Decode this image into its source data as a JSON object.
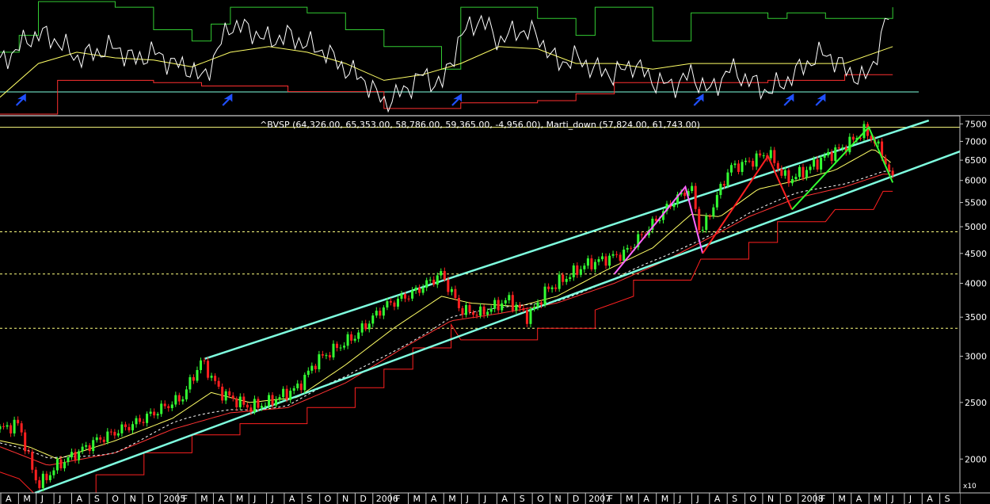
{
  "colors": {
    "background": "#000000",
    "axis": "#c8c8c8",
    "channel": "#7fffe0",
    "guide_level": "#ffff80",
    "price_up": "#33ff33",
    "price_down": "#ff2020",
    "ma_fast": "#ffff66",
    "ma_slow": "#ff3333",
    "stop_line": "#ff2020",
    "osc_white": "#ffffff",
    "osc_yellow": "#ffff66",
    "osc_red": "#ff3030",
    "osc_green": "#33cc33",
    "osc_baseline": "#7fffe0",
    "zigzag_pink": "#ff66ff",
    "zigzag_red": "#ff2020",
    "zigzag_green": "#33ff33",
    "signal_arrow": "#2050ff"
  },
  "chart_data": {
    "type": "candlestick",
    "title": "^BVSP (64,326.00, 65,353.00, 58,786.00, 59,365.00, -4,956.00), Marti_down (57,824.00, 61,743.00)",
    "y_scale": "log",
    "y_multiplier_label": "x10",
    "ylim": [
      17500,
      76500
    ],
    "y_tick_labels": [
      "7500",
      "7000",
      "6500",
      "6000",
      "5500",
      "5000",
      "4500",
      "4000",
      "3500",
      "3000",
      "2500",
      "2000"
    ],
    "y_ticks": [
      75000,
      70000,
      65000,
      60000,
      55000,
      50000,
      45000,
      40000,
      35000,
      30000,
      25000,
      20000
    ],
    "x_labels": [
      "A",
      "M",
      "J",
      "J",
      "A",
      "S",
      "O",
      "N",
      "D",
      "2005",
      "F",
      "M",
      "A",
      "M",
      "J",
      "J",
      "A",
      "S",
      "O",
      "N",
      "D",
      "2006",
      "F",
      "M",
      "A",
      "M",
      "J",
      "J",
      "A",
      "S",
      "O",
      "N",
      "D",
      "2007",
      "F",
      "M",
      "A",
      "M",
      "J",
      "J",
      "A",
      "S",
      "O",
      "N",
      "D",
      "2008",
      "F",
      "M",
      "A",
      "M",
      "J",
      "J",
      "A",
      "S"
    ],
    "horizontal_levels": [
      74000,
      49000,
      41500,
      33500
    ],
    "channel_upper": [
      [
        0.2135,
        29700
      ],
      [
        0.9676,
        76000
      ]
    ],
    "channel_lower": [
      [
        0.0363,
        17500
      ],
      [
        0.9676,
        64300
      ]
    ],
    "price_anchors": [
      [
        0.0,
        22500
      ],
      [
        0.02,
        23000
      ],
      [
        0.03,
        20000
      ],
      [
        0.04,
        18000
      ],
      [
        0.06,
        19500
      ],
      [
        0.1,
        21500
      ],
      [
        0.14,
        23000
      ],
      [
        0.17,
        24500
      ],
      [
        0.19,
        25500
      ],
      [
        0.21,
        29500
      ],
      [
        0.23,
        26000
      ],
      [
        0.26,
        24500
      ],
      [
        0.28,
        25000
      ],
      [
        0.31,
        26500
      ],
      [
        0.33,
        29500
      ],
      [
        0.37,
        32500
      ],
      [
        0.4,
        36500
      ],
      [
        0.43,
        38500
      ],
      [
        0.46,
        41500
      ],
      [
        0.48,
        36000
      ],
      [
        0.5,
        35500
      ],
      [
        0.53,
        37500
      ],
      [
        0.55,
        35000
      ],
      [
        0.57,
        39000
      ],
      [
        0.61,
        43000
      ],
      [
        0.65,
        45000
      ],
      [
        0.67,
        48500
      ],
      [
        0.7,
        55000
      ],
      [
        0.72,
        58500
      ],
      [
        0.73,
        48500
      ],
      [
        0.74,
        53000
      ],
      [
        0.76,
        63000
      ],
      [
        0.78,
        64500
      ],
      [
        0.8,
        67000
      ],
      [
        0.82,
        60000
      ],
      [
        0.84,
        62500
      ],
      [
        0.86,
        66000
      ],
      [
        0.88,
        68500
      ],
      [
        0.9,
        73000
      ],
      [
        0.91,
        70500
      ],
      [
        0.92,
        66000
      ],
      [
        0.93,
        60000
      ]
    ],
    "ma_fast_anchors": [
      [
        0.0,
        21500
      ],
      [
        0.03,
        21000
      ],
      [
        0.06,
        20000
      ],
      [
        0.12,
        21500
      ],
      [
        0.18,
        23500
      ],
      [
        0.22,
        26000
      ],
      [
        0.26,
        25000
      ],
      [
        0.31,
        25500
      ],
      [
        0.36,
        29000
      ],
      [
        0.41,
        33500
      ],
      [
        0.46,
        38000
      ],
      [
        0.49,
        37000
      ],
      [
        0.54,
        36500
      ],
      [
        0.58,
        38000
      ],
      [
        0.63,
        42000
      ],
      [
        0.68,
        46000
      ],
      [
        0.72,
        52500
      ],
      [
        0.75,
        52000
      ],
      [
        0.79,
        58000
      ],
      [
        0.83,
        60000
      ],
      [
        0.87,
        62500
      ],
      [
        0.91,
        68000
      ],
      [
        0.93,
        64000
      ]
    ],
    "ma_slow_anchors": [
      [
        0.0,
        21000
      ],
      [
        0.05,
        19500
      ],
      [
        0.12,
        20500
      ],
      [
        0.18,
        22500
      ],
      [
        0.24,
        24000
      ],
      [
        0.3,
        24500
      ],
      [
        0.36,
        27000
      ],
      [
        0.42,
        31000
      ],
      [
        0.47,
        34500
      ],
      [
        0.52,
        35500
      ],
      [
        0.58,
        37000
      ],
      [
        0.64,
        40000
      ],
      [
        0.69,
        43500
      ],
      [
        0.73,
        47000
      ],
      [
        0.78,
        52000
      ],
      [
        0.83,
        56000
      ],
      [
        0.88,
        58500
      ],
      [
        0.92,
        61500
      ],
      [
        0.93,
        61500
      ]
    ],
    "stop_anchors": [
      [
        0.0,
        19000
      ],
      [
        0.02,
        18500
      ],
      [
        0.035,
        17500
      ],
      [
        0.1,
        17500
      ],
      [
        0.1,
        18800
      ],
      [
        0.15,
        18800
      ],
      [
        0.15,
        20500
      ],
      [
        0.2,
        20500
      ],
      [
        0.2,
        22000
      ],
      [
        0.25,
        22000
      ],
      [
        0.25,
        23000
      ],
      [
        0.32,
        23000
      ],
      [
        0.32,
        24500
      ],
      [
        0.37,
        24500
      ],
      [
        0.37,
        26500
      ],
      [
        0.4,
        26500
      ],
      [
        0.4,
        28500
      ],
      [
        0.43,
        28500
      ],
      [
        0.43,
        31000
      ],
      [
        0.47,
        31000
      ],
      [
        0.47,
        34000
      ],
      [
        0.48,
        32000
      ],
      [
        0.56,
        32000
      ],
      [
        0.56,
        33500
      ],
      [
        0.62,
        33500
      ],
      [
        0.62,
        36000
      ],
      [
        0.66,
        38000
      ],
      [
        0.66,
        40500
      ],
      [
        0.72,
        40500
      ],
      [
        0.73,
        44000
      ],
      [
        0.78,
        44000
      ],
      [
        0.78,
        47000
      ],
      [
        0.81,
        47000
      ],
      [
        0.81,
        51000
      ],
      [
        0.86,
        51000
      ],
      [
        0.87,
        53500
      ],
      [
        0.91,
        53500
      ],
      [
        0.92,
        57500
      ],
      [
        0.93,
        57500
      ]
    ],
    "zigzag_pink": [
      [
        0.64,
        41500
      ],
      [
        0.714,
        58500
      ],
      [
        0.732,
        45000
      ]
    ],
    "zigzag_red": [
      [
        0.732,
        45000
      ],
      [
        0.8,
        66000
      ],
      [
        0.825,
        53500
      ]
    ],
    "zigzag_green": [
      [
        0.825,
        53500
      ],
      [
        0.905,
        74000
      ],
      [
        0.93,
        59500
      ]
    ],
    "oscillator": {
      "white": [
        [
          0.0,
          0.45
        ],
        [
          0.02,
          0.6
        ],
        [
          0.04,
          0.72
        ],
        [
          0.06,
          0.65
        ],
        [
          0.08,
          0.5
        ],
        [
          0.1,
          0.55
        ],
        [
          0.12,
          0.6
        ],
        [
          0.14,
          0.48
        ],
        [
          0.16,
          0.55
        ],
        [
          0.18,
          0.45
        ],
        [
          0.2,
          0.4
        ],
        [
          0.21,
          0.3
        ],
        [
          0.22,
          0.45
        ],
        [
          0.24,
          0.8
        ],
        [
          0.26,
          0.75
        ],
        [
          0.28,
          0.65
        ],
        [
          0.3,
          0.7
        ],
        [
          0.32,
          0.62
        ],
        [
          0.34,
          0.55
        ],
        [
          0.36,
          0.4
        ],
        [
          0.38,
          0.3
        ],
        [
          0.4,
          0.1
        ],
        [
          0.42,
          0.2
        ],
        [
          0.44,
          0.35
        ],
        [
          0.46,
          0.25
        ],
        [
          0.48,
          0.7
        ],
        [
          0.5,
          0.85
        ],
        [
          0.52,
          0.65
        ],
        [
          0.54,
          0.75
        ],
        [
          0.56,
          0.7
        ],
        [
          0.58,
          0.45
        ],
        [
          0.6,
          0.5
        ],
        [
          0.62,
          0.4
        ],
        [
          0.64,
          0.35
        ],
        [
          0.66,
          0.45
        ],
        [
          0.68,
          0.3
        ],
        [
          0.7,
          0.25
        ],
        [
          0.72,
          0.35
        ],
        [
          0.74,
          0.2
        ],
        [
          0.76,
          0.4
        ],
        [
          0.78,
          0.3
        ],
        [
          0.8,
          0.2
        ],
        [
          0.82,
          0.3
        ],
        [
          0.84,
          0.45
        ],
        [
          0.86,
          0.55
        ],
        [
          0.88,
          0.4
        ],
        [
          0.9,
          0.3
        ],
        [
          0.91,
          0.45
        ],
        [
          0.92,
          0.75
        ],
        [
          0.93,
          0.95
        ]
      ],
      "yellow": [
        [
          0.0,
          0.15
        ],
        [
          0.04,
          0.45
        ],
        [
          0.08,
          0.55
        ],
        [
          0.12,
          0.5
        ],
        [
          0.16,
          0.48
        ],
        [
          0.2,
          0.42
        ],
        [
          0.24,
          0.55
        ],
        [
          0.28,
          0.6
        ],
        [
          0.32,
          0.55
        ],
        [
          0.36,
          0.45
        ],
        [
          0.4,
          0.3
        ],
        [
          0.44,
          0.35
        ],
        [
          0.48,
          0.45
        ],
        [
          0.52,
          0.6
        ],
        [
          0.56,
          0.58
        ],
        [
          0.6,
          0.45
        ],
        [
          0.64,
          0.45
        ],
        [
          0.68,
          0.4
        ],
        [
          0.72,
          0.45
        ],
        [
          0.76,
          0.45
        ],
        [
          0.8,
          0.45
        ],
        [
          0.84,
          0.45
        ],
        [
          0.88,
          0.45
        ],
        [
          0.93,
          0.6
        ]
      ],
      "red": [
        [
          0.0,
          0.0
        ],
        [
          0.06,
          0.3
        ],
        [
          0.1,
          0.3
        ],
        [
          0.16,
          0.28
        ],
        [
          0.21,
          0.25
        ],
        [
          0.26,
          0.25
        ],
        [
          0.3,
          0.2
        ],
        [
          0.34,
          0.2
        ],
        [
          0.4,
          0.05
        ],
        [
          0.44,
          0.05
        ],
        [
          0.48,
          0.1
        ],
        [
          0.52,
          0.1
        ],
        [
          0.56,
          0.12
        ],
        [
          0.6,
          0.18
        ],
        [
          0.64,
          0.28
        ],
        [
          0.68,
          0.28
        ],
        [
          0.72,
          0.28
        ],
        [
          0.76,
          0.28
        ],
        [
          0.8,
          0.3
        ],
        [
          0.84,
          0.3
        ],
        [
          0.88,
          0.35
        ],
        [
          0.93,
          0.35
        ]
      ],
      "green": [
        [
          0.0,
          0.55
        ],
        [
          0.02,
          0.7
        ],
        [
          0.04,
          1.0
        ],
        [
          0.08,
          1.0
        ],
        [
          0.12,
          0.95
        ],
        [
          0.16,
          0.75
        ],
        [
          0.2,
          0.65
        ],
        [
          0.22,
          0.8
        ],
        [
          0.24,
          0.95
        ],
        [
          0.28,
          0.95
        ],
        [
          0.32,
          0.9
        ],
        [
          0.36,
          0.75
        ],
        [
          0.4,
          0.6
        ],
        [
          0.46,
          0.4
        ],
        [
          0.48,
          0.95
        ],
        [
          0.52,
          0.95
        ],
        [
          0.56,
          0.85
        ],
        [
          0.6,
          0.7
        ],
        [
          0.62,
          0.95
        ],
        [
          0.64,
          0.95
        ],
        [
          0.68,
          0.65
        ],
        [
          0.72,
          0.9
        ],
        [
          0.74,
          0.9
        ],
        [
          0.8,
          0.85
        ],
        [
          0.82,
          0.9
        ],
        [
          0.86,
          0.85
        ],
        [
          0.9,
          0.85
        ],
        [
          0.93,
          0.95
        ]
      ],
      "signal_arrows": [
        0.022,
        0.237,
        0.476,
        0.728,
        0.822,
        0.855
      ]
    }
  }
}
